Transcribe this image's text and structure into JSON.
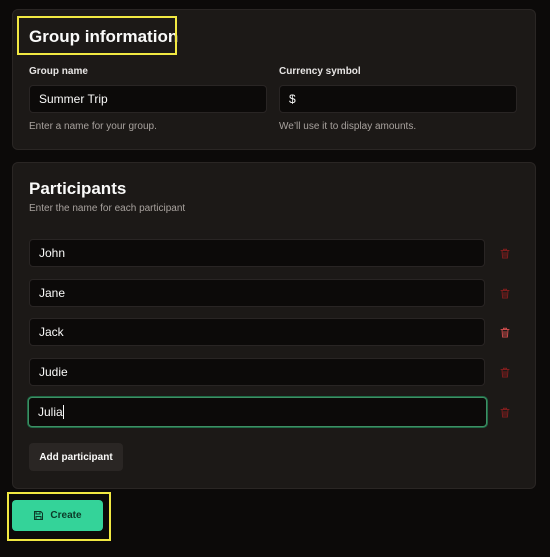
{
  "group_info": {
    "title": "Group information",
    "group_name": {
      "label": "Group name",
      "value": "Summer Trip",
      "hint": "Enter a name for your group."
    },
    "currency": {
      "label": "Currency symbol",
      "value": "$",
      "hint": "We’ll use it to display amounts."
    }
  },
  "participants": {
    "title": "Participants",
    "subtitle": "Enter the name for each participant",
    "items": [
      "John",
      "Jane",
      "Jack",
      "Judie",
      "Julia"
    ],
    "add_label": "Add participant"
  },
  "create_label": "Create",
  "colors": {
    "accent": "#34d399",
    "highlight": "#f1e842",
    "danger": "#7f1d1d",
    "background": "#0c0a09",
    "card": "#1c1917"
  },
  "icons": {
    "remove": "trash-icon",
    "create": "save-icon"
  }
}
